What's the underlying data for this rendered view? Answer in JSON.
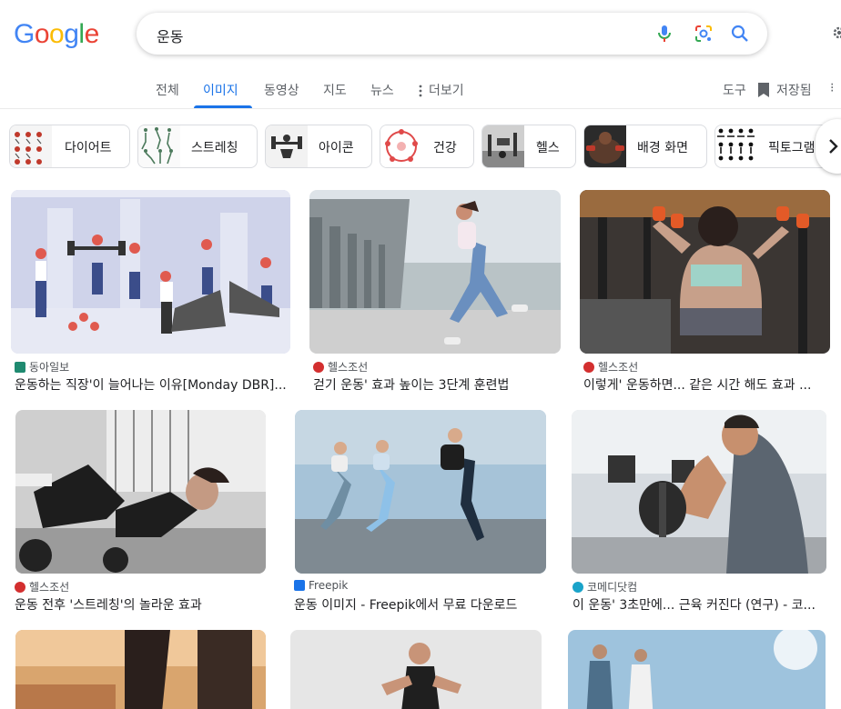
{
  "logo": [
    "G",
    "o",
    "o",
    "g",
    "l",
    "e"
  ],
  "logo_colors": [
    "#4285F4",
    "#EA4335",
    "#FBBC05",
    "#4285F4",
    "#34A853",
    "#EA4335"
  ],
  "search": {
    "query": "운동"
  },
  "tabs": [
    {
      "label": "전체"
    },
    {
      "label": "이미지"
    },
    {
      "label": "동영상"
    },
    {
      "label": "지도"
    },
    {
      "label": "뉴스"
    },
    {
      "label": "더보기"
    }
  ],
  "tools": {
    "tools_label": "도구",
    "saved_label": "저장됨"
  },
  "chips": [
    "다이어트",
    "스트레칭",
    "아이콘",
    "건강",
    "헬스",
    "배경 화면",
    "픽토그램"
  ],
  "results": [
    {
      "source": "동아일보",
      "title": "운동하는 직장'이 늘어나는 이유[Monday DBR]..."
    },
    {
      "source": "헬스조선",
      "title": "걷기 운동' 효과 높이는 3단계 훈련법"
    },
    {
      "source": "헬스조선",
      "title": "이렇게' 운동하면... 같은 시간 해도 효과 ..."
    },
    {
      "source": "헬스조선",
      "title": "운동 전후 '스트레칭'의 놀라운 효과"
    },
    {
      "source": "Freepik",
      "title": "운동 이미지 - Freepik에서 무료 다운로드"
    },
    {
      "source": "코메디닷컴",
      "title": "이 운동' 3초만에... 근육 커진다 (연구) - 코..."
    }
  ],
  "colors": {
    "accent": "#1a73e8",
    "text": "#202124",
    "muted": "#5f6368"
  }
}
